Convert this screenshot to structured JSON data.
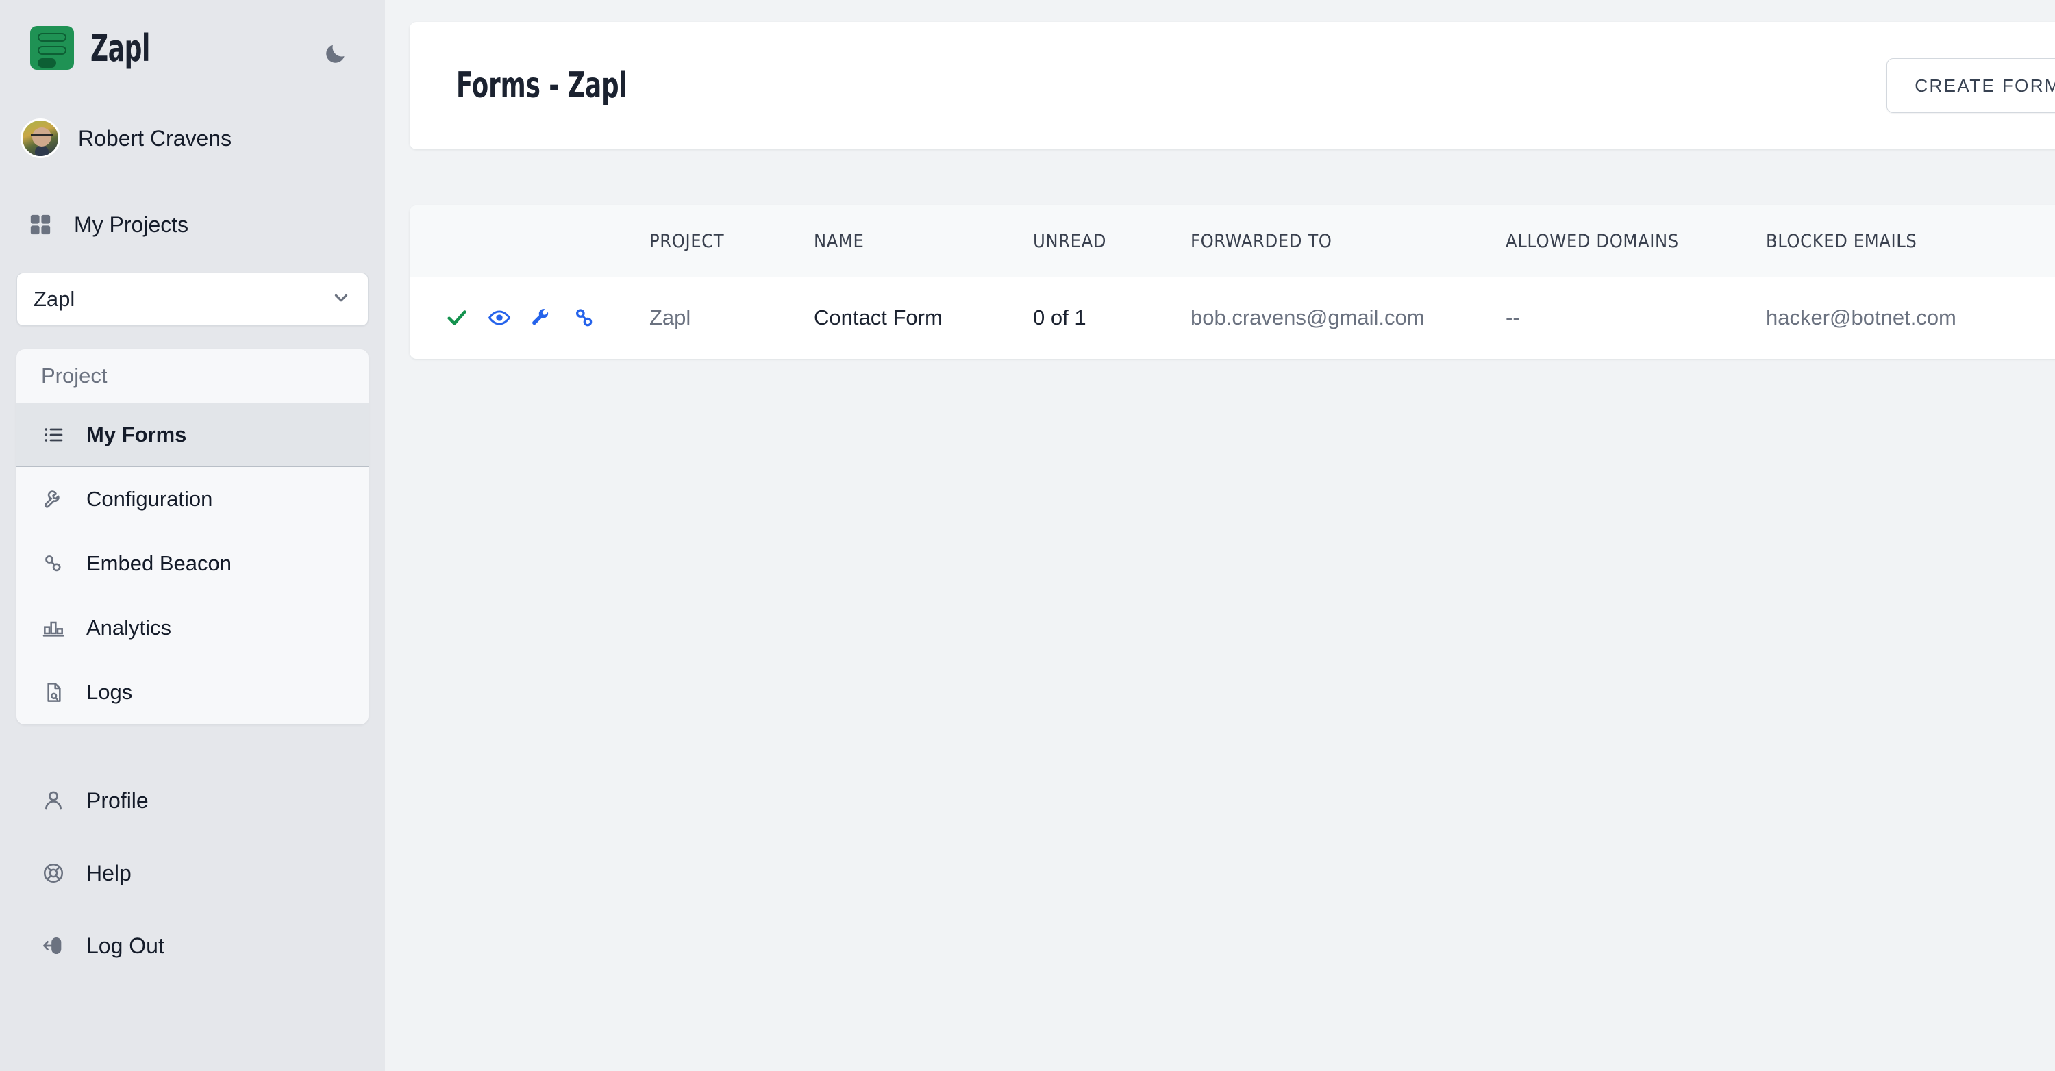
{
  "sidebar": {
    "brand": {
      "name": "Zapl",
      "logo_icon": "zapl-logo-icon",
      "logo_color": "#1f9254"
    },
    "theme_toggle": {
      "icon": "moon-icon"
    },
    "user": {
      "name": "Robert Cravens",
      "avatar_icon": "user-avatar"
    },
    "projects_nav": {
      "label": "My Projects",
      "icon": "grid-icon"
    },
    "project_select": {
      "value": "Zapl",
      "icon": "chevron-down-icon"
    },
    "menu": {
      "heading": "Project",
      "items": [
        {
          "label": "My Forms",
          "icon": "list-icon",
          "active": true
        },
        {
          "label": "Configuration",
          "icon": "wrench-icon",
          "active": false
        },
        {
          "label": "Embed Beacon",
          "icon": "link-icon",
          "active": false
        },
        {
          "label": "Analytics",
          "icon": "bar-chart-icon",
          "active": false
        },
        {
          "label": "Logs",
          "icon": "document-search-icon",
          "active": false
        }
      ]
    },
    "bottom_items": [
      {
        "label": "Profile",
        "icon": "person-icon"
      },
      {
        "label": "Help",
        "icon": "lifebuoy-icon"
      },
      {
        "label": "Log Out",
        "icon": "logout-icon"
      }
    ]
  },
  "header": {
    "title": "Forms - Zapl",
    "create_button": "CREATE FORM"
  },
  "table": {
    "columns": [
      "",
      "PROJECT",
      "NAME",
      "UNREAD",
      "FORWARDED TO",
      "ALLOWED DOMAINS",
      "BLOCKED EMAILS",
      ""
    ],
    "rows": [
      {
        "actions": [
          {
            "icon": "check-icon",
            "color": "#14924e"
          },
          {
            "icon": "eye-icon",
            "color": "#2563eb"
          },
          {
            "icon": "wrench-icon",
            "color": "#2563eb"
          },
          {
            "icon": "link-icon",
            "color": "#2563eb"
          }
        ],
        "project": "Zapl",
        "name": "Contact Form",
        "unread": "0 of 1",
        "forwarded_to": "bob.cravens@gmail.com",
        "allowed_domains": "--",
        "blocked_emails": "hacker@botnet.com",
        "delete_icon": "delete-x-icon",
        "delete_glyph": "✖"
      }
    ]
  },
  "colors": {
    "sidebar_bg": "#e5e7eb",
    "main_bg": "#f1f3f5",
    "accent_green": "#1f9254",
    "accent_blue": "#2563eb",
    "danger_red": "#ef4444",
    "text_dark": "#1b2230",
    "text_muted": "#6b7280"
  }
}
